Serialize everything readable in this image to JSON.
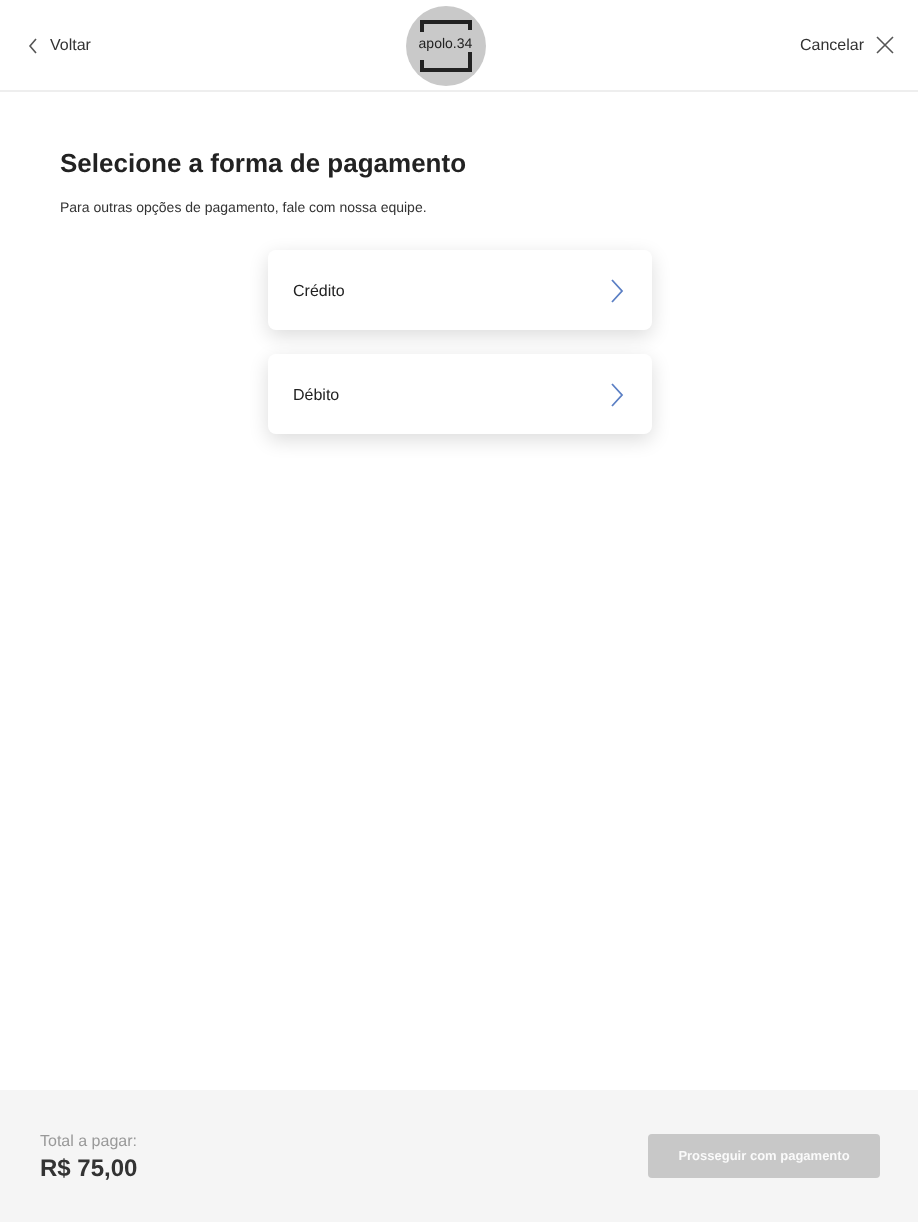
{
  "header": {
    "back": "Voltar",
    "logo": "apolo.34",
    "cancel": "Cancelar"
  },
  "title": "Selecione a forma de pagamento",
  "subtitle": "Para outras opções de pagamento, fale com nossa equipe.",
  "options": [
    {
      "label": "Crédito"
    },
    {
      "label": "Débito"
    }
  ],
  "footer": {
    "total_label": "Total a pagar:",
    "total": "R$ 75,00",
    "button": {
      "label": "Prosseguir com pagamento",
      "disabled": true
    }
  }
}
